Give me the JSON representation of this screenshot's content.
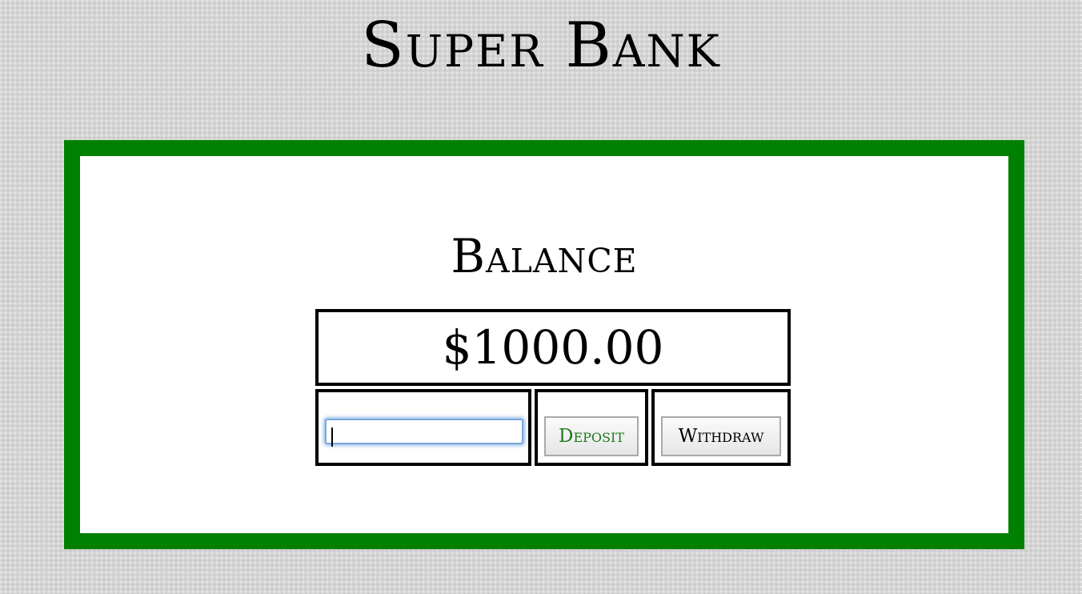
{
  "header": {
    "title": "Super Bank"
  },
  "account": {
    "balance_heading": "Balance",
    "balance_value": "$1000.00"
  },
  "transaction": {
    "amount_value": "",
    "amount_placeholder": "",
    "deposit_label": "Deposit",
    "withdraw_label": "Withdraw"
  },
  "colors": {
    "accent": "#008000",
    "deposit_text": "#1a7a1a",
    "focus_ring": "#7aa7d9"
  }
}
